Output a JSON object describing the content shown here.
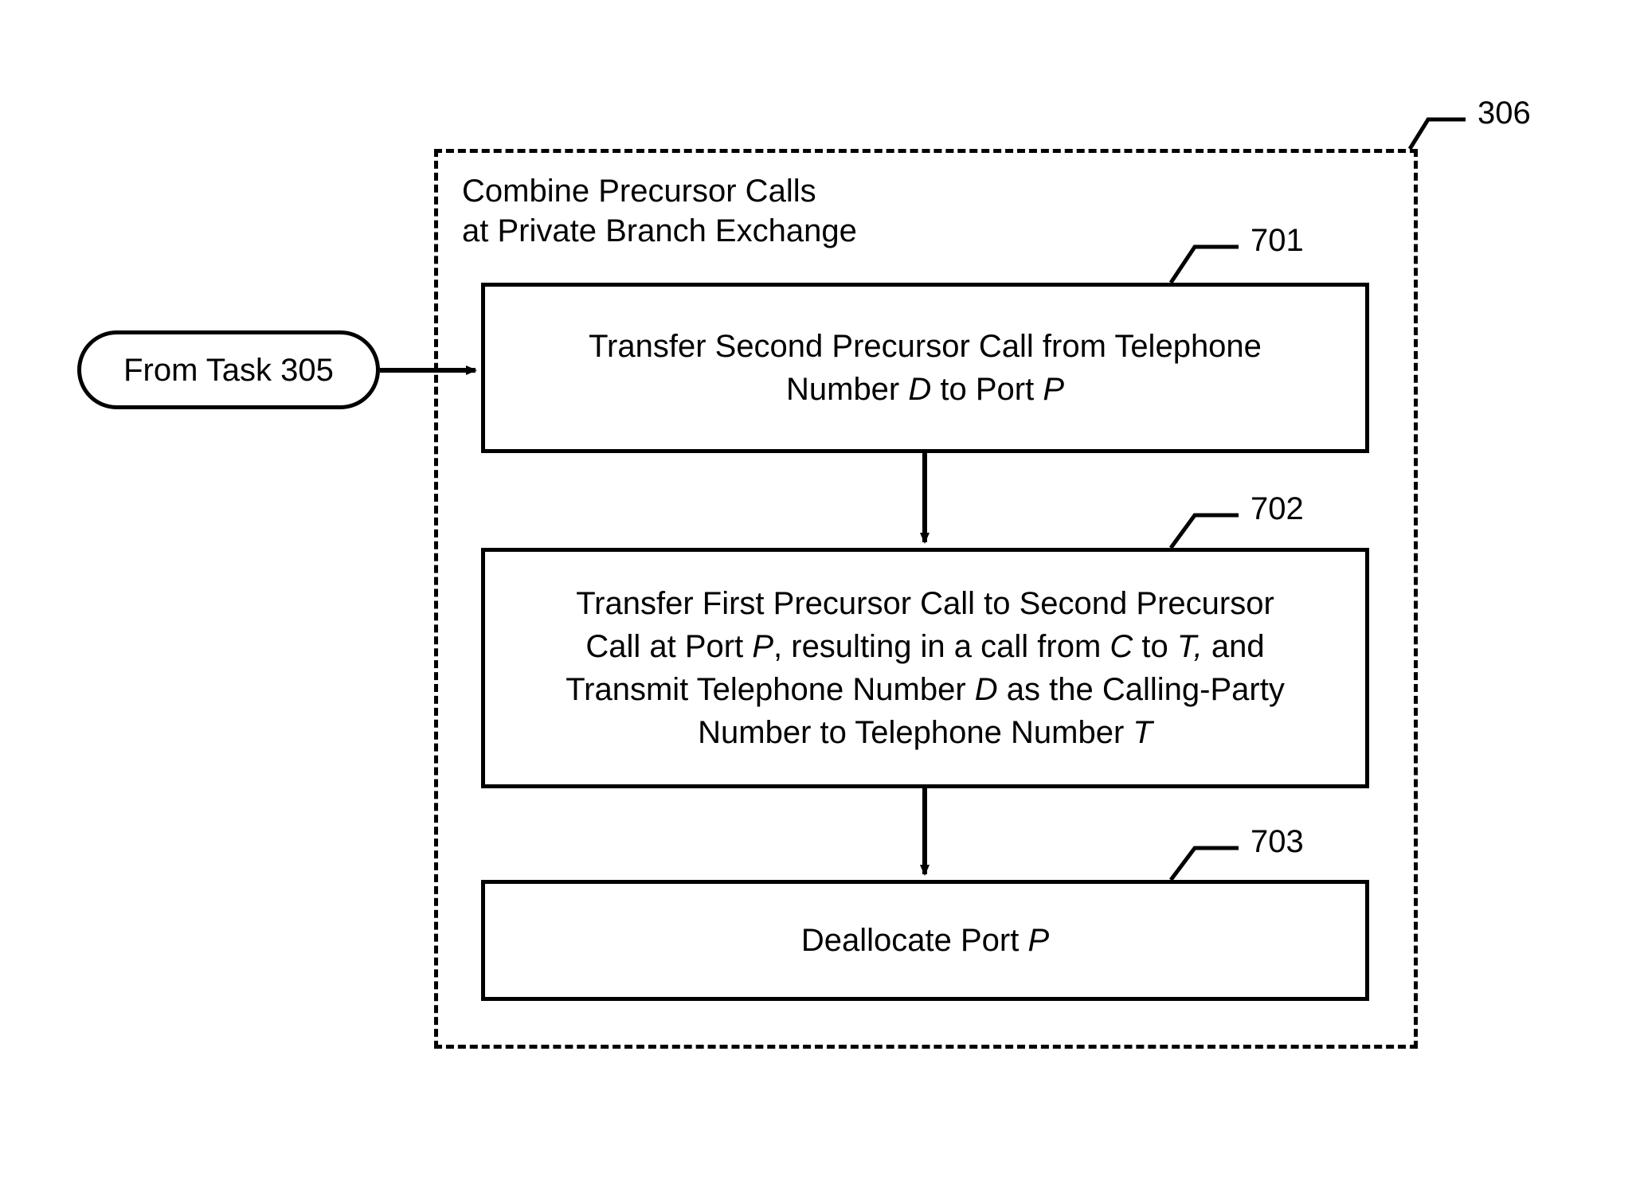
{
  "diagram": {
    "container_ref": "306",
    "container_title_line1": "Combine Precursor Calls",
    "container_title_line2": "at Private Branch Exchange",
    "start_label": "From Task 305",
    "block701_ref": "701",
    "block701_line1": "Transfer Second Precursor Call from Telephone",
    "block701_line2_a": "Number ",
    "block701_line2_b": "D",
    "block701_line2_c": " to Port ",
    "block701_line2_d": "P",
    "block702_ref": "702",
    "block702_line1": "Transfer First Precursor Call to Second Precursor",
    "block702_line2_a": "Call at Port ",
    "block702_line2_b": "P",
    "block702_line2_c": ", resulting in a call from ",
    "block702_line2_d": "C",
    "block702_line2_e": " to ",
    "block702_line2_f": "T,",
    "block702_line2_g": " and",
    "block702_line3_a": "Transmit Telephone Number ",
    "block702_line3_b": "D",
    "block702_line3_c": " as the Calling-Party",
    "block702_line4_a": "Number to Telephone Number ",
    "block702_line4_b": "T",
    "block703_ref": "703",
    "block703_a": "Deallocate Port ",
    "block703_b": "P"
  }
}
